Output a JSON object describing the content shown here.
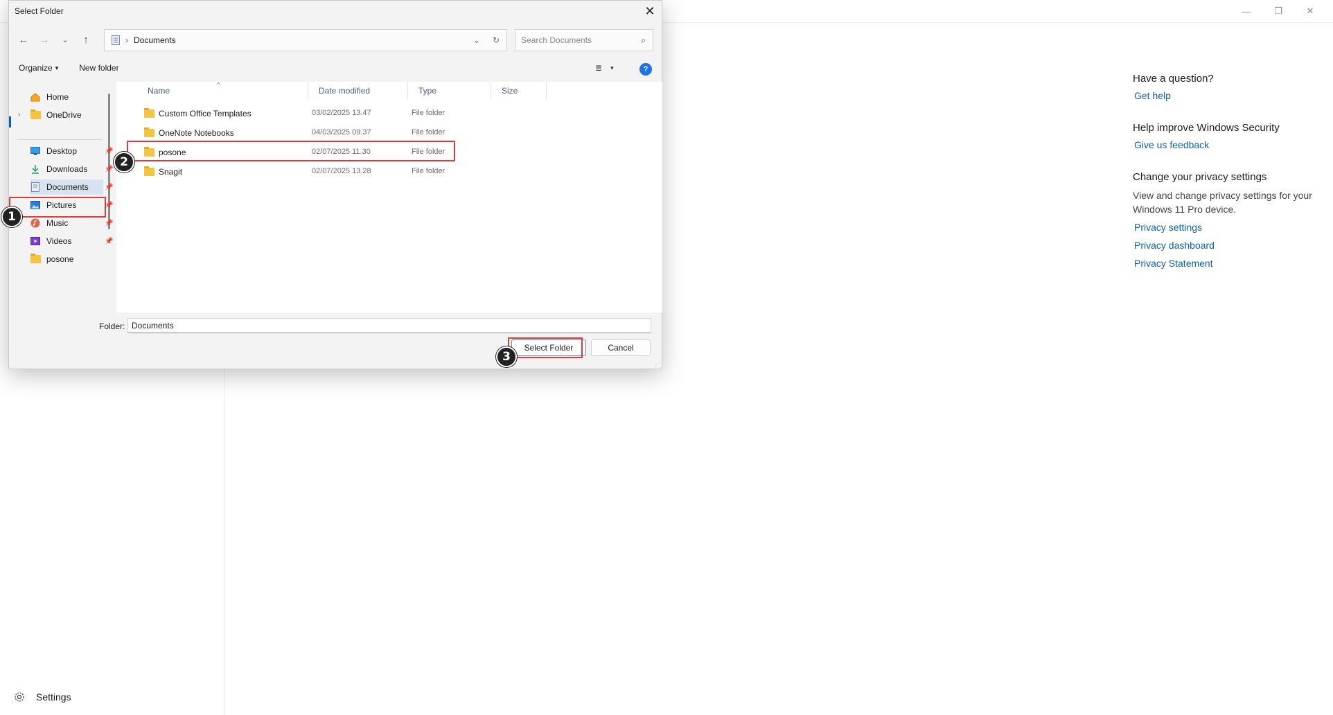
{
  "background_app": {
    "window_controls": {
      "minimize": "—",
      "restore": "❐",
      "close": "✕"
    },
    "settings_label": "Settings",
    "right_panel": {
      "question_heading": "Have a question?",
      "get_help": "Get help",
      "improve_heading": "Help improve Windows Security",
      "feedback": "Give us feedback",
      "privacy_heading": "Change your privacy settings",
      "privacy_text": "View and change privacy settings for your Windows 11 Pro device.",
      "privacy_settings": "Privacy settings",
      "privacy_dashboard": "Privacy dashboard",
      "privacy_statement": "Privacy Statement"
    }
  },
  "dialog": {
    "title": "Select Folder",
    "address_crumb": "Documents",
    "search_placeholder": "Search Documents",
    "toolbar": {
      "organize": "Organize",
      "new_folder": "New folder"
    },
    "nav_items": {
      "home": "Home",
      "onedrive": "OneDrive",
      "desktop": "Desktop",
      "downloads": "Downloads",
      "documents": "Documents",
      "pictures": "Pictures",
      "music": "Music",
      "videos": "Videos",
      "posone": "posone"
    },
    "columns": {
      "name": "Name",
      "date": "Date modified",
      "type": "Type",
      "size": "Size"
    },
    "files": [
      {
        "name": "Custom Office Templates",
        "date": "03/02/2025 13.47",
        "type": "File folder"
      },
      {
        "name": "OneNote Notebooks",
        "date": "04/03/2025 09.37",
        "type": "File folder"
      },
      {
        "name": "posone",
        "date": "02/07/2025 11.30",
        "type": "File folder"
      },
      {
        "name": "Snagit",
        "date": "02/07/2025 13.28",
        "type": "File folder"
      }
    ],
    "folder_label": "Folder:",
    "folder_value": "Documents",
    "select_button": "Select Folder",
    "cancel_button": "Cancel"
  },
  "annotations": {
    "step1": "1",
    "step2": "2",
    "step3": "3"
  },
  "colors": {
    "accent": "#0a5fb4",
    "highlight": "#e03c3c",
    "badge": "#222222"
  }
}
